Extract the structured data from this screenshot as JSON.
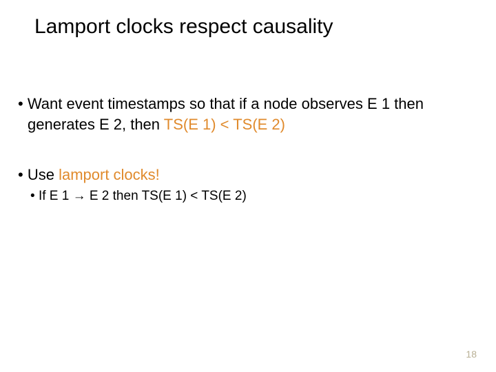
{
  "title": "Lamport clocks respect causality",
  "bullets": {
    "b1": {
      "prefix": "Want event timestamps so that if a node observes E 1 then generates E 2, then ",
      "accent": "TS(E 1) < TS(E 2)"
    },
    "b2": {
      "prefix": "Use ",
      "accent": "lamport clocks!",
      "sub": {
        "pre": "If E 1 ",
        "arrow": "→",
        "post": " E 2 then TS(E 1) < TS(E 2)"
      }
    }
  },
  "page_number": "18"
}
